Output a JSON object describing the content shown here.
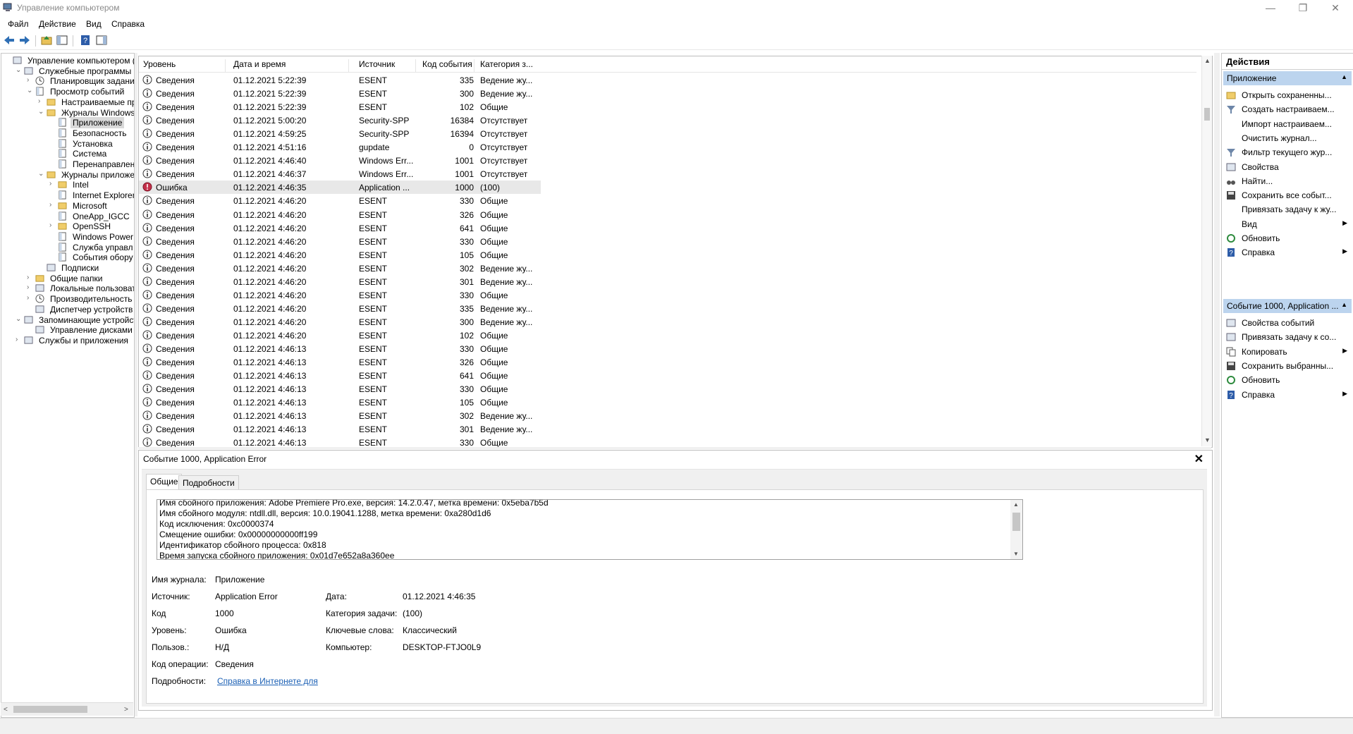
{
  "window": {
    "title": "Управление компьютером",
    "minimize": "—",
    "restore": "❐",
    "close": "✕"
  },
  "menu": [
    "Файл",
    "Действие",
    "Вид",
    "Справка"
  ],
  "toolbar": [
    "back-icon",
    "forward-icon",
    "up-folder-icon",
    "show-tree-icon",
    "help-icon",
    "show-actions-icon"
  ],
  "tree": [
    {
      "label": "Управление компьютером (л",
      "level": 0,
      "exp": "",
      "icon": "computer-management-icon"
    },
    {
      "label": "Служебные программы",
      "level": 1,
      "exp": "v",
      "icon": "tools-icon"
    },
    {
      "label": "Планировщик заданий",
      "level": 2,
      "exp": ">",
      "icon": "clock-icon"
    },
    {
      "label": "Просмотр событий",
      "level": 2,
      "exp": "v",
      "icon": "event-viewer-icon"
    },
    {
      "label": "Настраиваемые пр",
      "level": 3,
      "exp": ">",
      "icon": "folder-icon"
    },
    {
      "label": "Журналы Windows",
      "level": 3,
      "exp": "v",
      "icon": "folder-icon"
    },
    {
      "label": "Приложение",
      "level": 4,
      "exp": "",
      "icon": "log-icon",
      "selected": true
    },
    {
      "label": "Безопасность",
      "level": 4,
      "exp": "",
      "icon": "log-icon"
    },
    {
      "label": "Установка",
      "level": 4,
      "exp": "",
      "icon": "log-icon"
    },
    {
      "label": "Система",
      "level": 4,
      "exp": "",
      "icon": "log-icon"
    },
    {
      "label": "Перенаправлен",
      "level": 4,
      "exp": "",
      "icon": "log-icon"
    },
    {
      "label": "Журналы приложе",
      "level": 3,
      "exp": "v",
      "icon": "folder-icon"
    },
    {
      "label": "Intel",
      "level": 4,
      "exp": ">",
      "icon": "folder-icon"
    },
    {
      "label": "Internet Explorer",
      "level": 4,
      "exp": "",
      "icon": "log-icon"
    },
    {
      "label": "Microsoft",
      "level": 4,
      "exp": ">",
      "icon": "folder-icon"
    },
    {
      "label": "OneApp_IGCC",
      "level": 4,
      "exp": "",
      "icon": "log-icon"
    },
    {
      "label": "OpenSSH",
      "level": 4,
      "exp": ">",
      "icon": "folder-icon"
    },
    {
      "label": "Windows Power",
      "level": 4,
      "exp": "",
      "icon": "log-icon"
    },
    {
      "label": "Служба управл",
      "level": 4,
      "exp": "",
      "icon": "log-icon"
    },
    {
      "label": "События обору",
      "level": 4,
      "exp": "",
      "icon": "log-icon"
    },
    {
      "label": "Подписки",
      "level": 3,
      "exp": "",
      "icon": "subscriptions-icon"
    },
    {
      "label": "Общие папки",
      "level": 2,
      "exp": ">",
      "icon": "shared-folder-icon"
    },
    {
      "label": "Локальные пользовате",
      "level": 2,
      "exp": ">",
      "icon": "users-icon"
    },
    {
      "label": "Производительность",
      "level": 2,
      "exp": ">",
      "icon": "performance-icon"
    },
    {
      "label": "Диспетчер устройств",
      "level": 2,
      "exp": "",
      "icon": "device-manager-icon"
    },
    {
      "label": "Запоминающие устройст",
      "level": 1,
      "exp": "v",
      "icon": "storage-icon"
    },
    {
      "label": "Управление дисками",
      "level": 2,
      "exp": "",
      "icon": "disk-icon"
    },
    {
      "label": "Службы и приложения",
      "level": 1,
      "exp": ">",
      "icon": "services-icon"
    }
  ],
  "events": {
    "headers": [
      "Уровень",
      "Дата и время",
      "Источник",
      "Код события",
      "Категория з..."
    ],
    "rows": [
      [
        "Сведения",
        "01.12.2021 5:22:39",
        "ESENT",
        "335",
        "Ведение жу..."
      ],
      [
        "Сведения",
        "01.12.2021 5:22:39",
        "ESENT",
        "300",
        "Ведение жу..."
      ],
      [
        "Сведения",
        "01.12.2021 5:22:39",
        "ESENT",
        "102",
        "Общие"
      ],
      [
        "Сведения",
        "01.12.2021 5:00:20",
        "Security-SPP",
        "16384",
        "Отсутствует"
      ],
      [
        "Сведения",
        "01.12.2021 4:59:25",
        "Security-SPP",
        "16394",
        "Отсутствует"
      ],
      [
        "Сведения",
        "01.12.2021 4:51:16",
        "gupdate",
        "0",
        "Отсутствует"
      ],
      [
        "Сведения",
        "01.12.2021 4:46:40",
        "Windows Err...",
        "1001",
        "Отсутствует"
      ],
      [
        "Сведения",
        "01.12.2021 4:46:37",
        "Windows Err...",
        "1001",
        "Отсутствует"
      ],
      [
        "Ошибка",
        "01.12.2021 4:46:35",
        "Application ...",
        "1000",
        "(100)"
      ],
      [
        "Сведения",
        "01.12.2021 4:46:20",
        "ESENT",
        "330",
        "Общие"
      ],
      [
        "Сведения",
        "01.12.2021 4:46:20",
        "ESENT",
        "326",
        "Общие"
      ],
      [
        "Сведения",
        "01.12.2021 4:46:20",
        "ESENT",
        "641",
        "Общие"
      ],
      [
        "Сведения",
        "01.12.2021 4:46:20",
        "ESENT",
        "330",
        "Общие"
      ],
      [
        "Сведения",
        "01.12.2021 4:46:20",
        "ESENT",
        "105",
        "Общие"
      ],
      [
        "Сведения",
        "01.12.2021 4:46:20",
        "ESENT",
        "302",
        "Ведение жу..."
      ],
      [
        "Сведения",
        "01.12.2021 4:46:20",
        "ESENT",
        "301",
        "Ведение жу..."
      ],
      [
        "Сведения",
        "01.12.2021 4:46:20",
        "ESENT",
        "330",
        "Общие"
      ],
      [
        "Сведения",
        "01.12.2021 4:46:20",
        "ESENT",
        "335",
        "Ведение жу..."
      ],
      [
        "Сведения",
        "01.12.2021 4:46:20",
        "ESENT",
        "300",
        "Ведение жу..."
      ],
      [
        "Сведения",
        "01.12.2021 4:46:20",
        "ESENT",
        "102",
        "Общие"
      ],
      [
        "Сведения",
        "01.12.2021 4:46:13",
        "ESENT",
        "330",
        "Общие"
      ],
      [
        "Сведения",
        "01.12.2021 4:46:13",
        "ESENT",
        "326",
        "Общие"
      ],
      [
        "Сведения",
        "01.12.2021 4:46:13",
        "ESENT",
        "641",
        "Общие"
      ],
      [
        "Сведения",
        "01.12.2021 4:46:13",
        "ESENT",
        "330",
        "Общие"
      ],
      [
        "Сведения",
        "01.12.2021 4:46:13",
        "ESENT",
        "105",
        "Общие"
      ],
      [
        "Сведения",
        "01.12.2021 4:46:13",
        "ESENT",
        "302",
        "Ведение жу..."
      ],
      [
        "Сведения",
        "01.12.2021 4:46:13",
        "ESENT",
        "301",
        "Ведение жу..."
      ],
      [
        "Сведения",
        "01.12.2021 4:46:13",
        "ESENT",
        "330",
        "Общие"
      ]
    ],
    "selected_index": 8
  },
  "detail": {
    "title": "Событие 1000, Application Error",
    "close": "✕",
    "tabs": [
      "Общие",
      "Подробности"
    ],
    "description_lines": [
      "Имя сбойного приложения: Adobe Premiere Pro.exe, версия: 14.2.0.47, метка времени: 0x5eba7b5d",
      "Имя сбойного модуля: ntdll.dll, версия: 10.0.19041.1288, метка времени: 0xa280d1d6",
      "Код исключения: 0xc0000374",
      "Смещение ошибки: 0x00000000000ff199",
      "Идентификатор сбойного процесса: 0x818",
      "Время запуска сбойного приложения: 0x01d7e652a8a360ee"
    ],
    "fields": {
      "log_name_label": "Имя журнала:",
      "log_name": "Приложение",
      "source_label": "Источник:",
      "source": "Application Error",
      "date_label": "Дата:",
      "date": "01.12.2021 4:46:35",
      "code_label": "Код",
      "code": "1000",
      "task_category_label": "Категория задачи:",
      "task_category": "(100)",
      "level_label": "Уровень:",
      "level": "Ошибка",
      "keywords_label": "Ключевые слова:",
      "keywords": "Классический",
      "user_label": "Пользов.:",
      "user": "Н/Д",
      "computer_label": "Компьютер:",
      "computer": "DESKTOP-FTJO0L9",
      "opcode_label": "Код операции:",
      "opcode": "Сведения",
      "more_info_label": "Подробности:",
      "more_info_link": "Справка в Интернете для "
    }
  },
  "actions": {
    "title": "Действия",
    "section1": "Приложение",
    "items1": [
      {
        "label": "Открыть сохраненны...",
        "icon": "open-folder-icon",
        "arrow": false
      },
      {
        "label": "Создать настраиваем...",
        "icon": "filter-new-icon",
        "arrow": false
      },
      {
        "label": "Импорт настраиваем...",
        "icon": "",
        "arrow": false
      },
      {
        "label": "Очистить журнал...",
        "icon": "",
        "arrow": false
      },
      {
        "label": "Фильтр текущего жур...",
        "icon": "filter-icon",
        "arrow": false
      },
      {
        "label": "Свойства",
        "icon": "properties-icon",
        "arrow": false
      },
      {
        "label": "Найти...",
        "icon": "binoculars-icon",
        "arrow": false
      },
      {
        "label": "Сохранить все событ...",
        "icon": "save-icon",
        "arrow": false
      },
      {
        "label": "Привязать задачу к жу...",
        "icon": "",
        "arrow": false
      },
      {
        "label": "Вид",
        "icon": "",
        "arrow": true
      },
      {
        "label": "Обновить",
        "icon": "refresh-icon",
        "arrow": false
      },
      {
        "label": "Справка",
        "icon": "help-icon",
        "arrow": true
      }
    ],
    "section2": "Событие 1000, Application ...",
    "items2": [
      {
        "label": "Свойства событий",
        "icon": "event-properties-icon",
        "arrow": false
      },
      {
        "label": "Привязать задачу к со...",
        "icon": "task-icon",
        "arrow": false
      },
      {
        "label": "Копировать",
        "icon": "copy-icon",
        "arrow": true
      },
      {
        "label": "Сохранить выбранны...",
        "icon": "save-icon",
        "arrow": false
      },
      {
        "label": "Обновить",
        "icon": "refresh-icon",
        "arrow": false
      },
      {
        "label": "Справка",
        "icon": "help-icon",
        "arrow": true
      }
    ]
  },
  "colors": {
    "accent": "#1a5fb4",
    "section_bg": "#bcd4ee",
    "error": "#c4314b",
    "selection": "#e8e8e8"
  }
}
